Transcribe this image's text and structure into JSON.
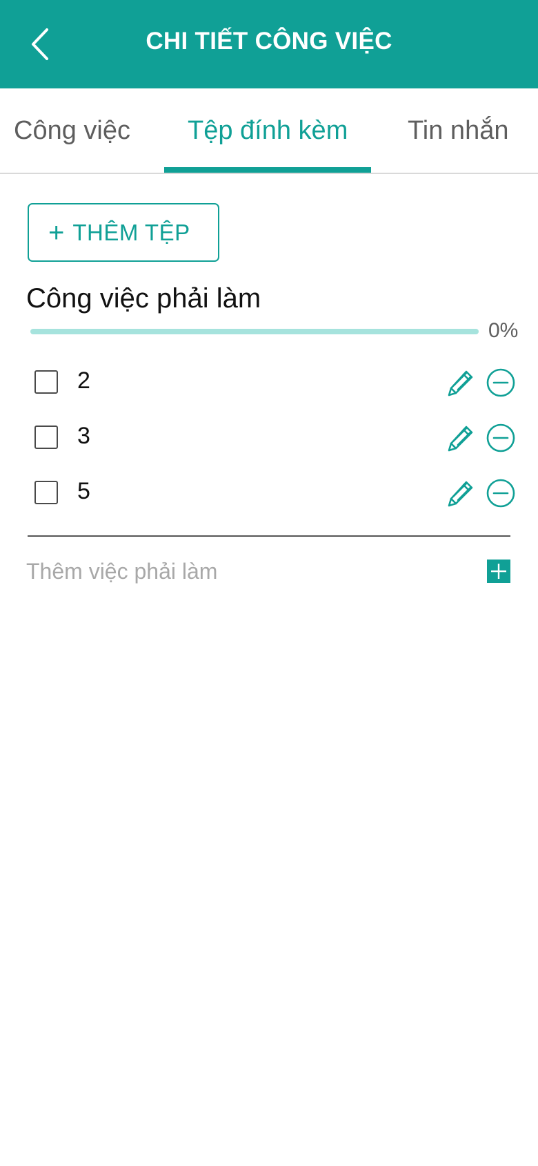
{
  "header": {
    "title": "CHI TIẾT CÔNG VIỆC",
    "back_icon": "chevron-left-icon"
  },
  "tabs": [
    {
      "label": "Công việc",
      "active": false
    },
    {
      "label": "Tệp đính kèm",
      "active": true
    },
    {
      "label": "Tin nhắn",
      "active": false
    }
  ],
  "attachments": {
    "add_button_label": "THÊM TỆP",
    "add_button_icon": "plus-icon"
  },
  "todo": {
    "title": "Công việc phải làm",
    "progress_percent": 0,
    "progress_text": "0%",
    "items": [
      {
        "text": "2",
        "checked": false
      },
      {
        "text": "3",
        "checked": false
      },
      {
        "text": "5",
        "checked": false
      }
    ],
    "add_placeholder": "Thêm việc phải làm",
    "item_icons": [
      "pencil-icon",
      "minus-circle-icon"
    ]
  },
  "colors": {
    "accent": "#10a096",
    "progress_track": "#a6e3dd",
    "header_text": "#ffffff"
  }
}
